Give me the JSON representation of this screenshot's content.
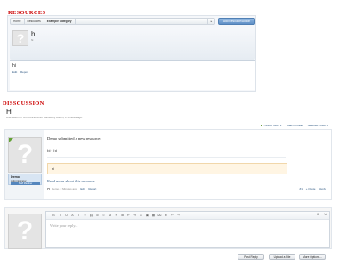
{
  "sections": {
    "resources": "RESOURCES",
    "discussion": "DISSCUSSION"
  },
  "resource": {
    "breadcrumbs": [
      "Home",
      "Resources",
      "Example Category"
    ],
    "breadcrumb_end": "▸",
    "add_button": "Add Resource/Addon",
    "title": "hi",
    "subtitle": "hi",
    "tab": "Overview",
    "body": "hi",
    "links": [
      "Edit",
      "Report"
    ]
  },
  "thread": {
    "title": "Hi",
    "meta": "Discussion in 'Announcements' started by Admin, 2 Minutes ago.",
    "tools": [
      "Thread Tools ▼",
      "Watch Thread",
      "Selected Posts: 0"
    ]
  },
  "post": {
    "username": "Demo",
    "role": "Administrator",
    "staff": "Staff Member",
    "header": "Demo submitted a new resource:",
    "line": "hi - hi",
    "quote": "hi",
    "read_more": "Read more about this resource...",
    "time": "Demo, 2 Minutes ago",
    "actions": [
      "Edit",
      "Report"
    ],
    "right_actions": [
      "#1",
      "+ Quote",
      "Reply"
    ]
  },
  "editor": {
    "toolbar": [
      "B",
      "I",
      "U",
      "A",
      "T",
      "≡",
      "⛓",
      "⊘",
      "☺",
      "⧉",
      "≡",
      "≔",
      "⇤",
      "⇥",
      "▭",
      "▣",
      "▦",
      "⌧",
      "⊕",
      "↶",
      "↷"
    ],
    "toolbar_right": [
      "⊞",
      "⇲"
    ],
    "placeholder": "Write your reply...",
    "buttons": {
      "post": "Post Reply",
      "upload": "Upload a File",
      "more": "More Options..."
    }
  },
  "colors": {
    "section_title": "#cc0000",
    "link": "#2c5680",
    "staff_bar": "#5586bd",
    "quote_bg": "#fff5e3"
  }
}
